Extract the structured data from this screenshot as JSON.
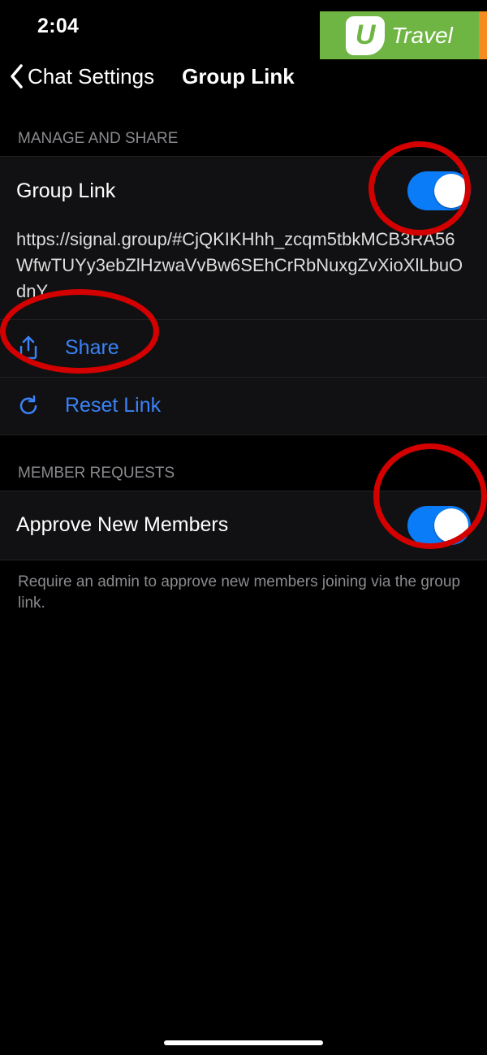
{
  "statusbar": {
    "time": "2:04"
  },
  "watermark": {
    "text": "Travel",
    "letter": "U"
  },
  "nav": {
    "back_label": "Chat Settings",
    "title": "Group Link"
  },
  "sections": {
    "manage": {
      "header": "MANAGE AND SHARE",
      "group_link_label": "Group Link",
      "group_link_on": true,
      "url": "https://signal.group/#CjQKIKHhh_zcqm5tbkMCB3RA56WfwTUYy3ebZlHzwaVvBw6SEhCrRbNuxgZvXioXlLbuOdnY",
      "share_label": "Share",
      "reset_label": "Reset Link"
    },
    "requests": {
      "header": "MEMBER REQUESTS",
      "approve_label": "Approve New Members",
      "approve_on": true,
      "footer": "Require an admin to approve new members joining via the group link."
    }
  }
}
